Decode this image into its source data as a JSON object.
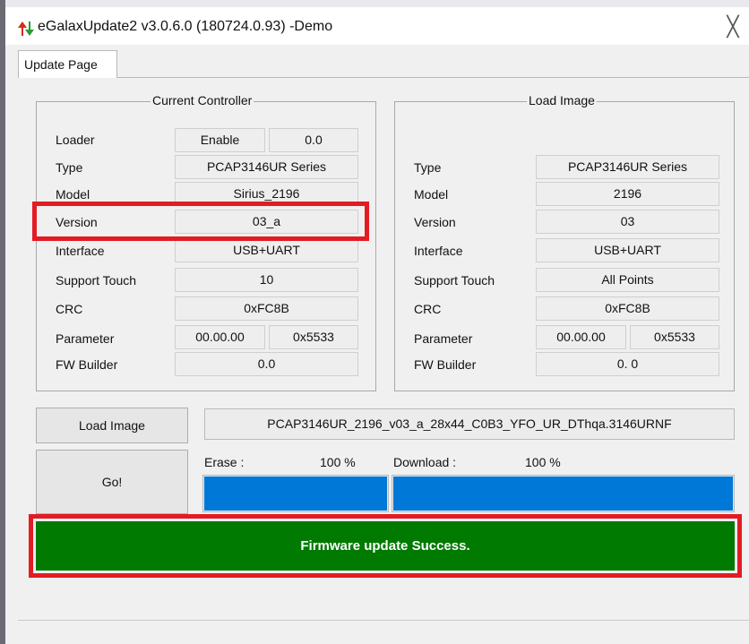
{
  "window": {
    "title": "eGalaxUpdate2 v3.0.6.0 (180724.0.93) -Demo",
    "close_glyph": "╳",
    "app_icon": "updown-arrows-icon"
  },
  "tabs": [
    {
      "label": "Update Page"
    }
  ],
  "current_controller": {
    "title": "Current Controller",
    "loader": {
      "label": "Loader",
      "value1": "Enable",
      "value2": "0.0"
    },
    "rows": [
      {
        "label": "Type",
        "value": "PCAP3146UR Series"
      },
      {
        "label": "Model",
        "value": "Sirius_2196"
      },
      {
        "label": "Version",
        "value": "03_a"
      },
      {
        "label": "Interface",
        "value": "USB+UART"
      },
      {
        "label": "Support Touch",
        "value": "10"
      },
      {
        "label": "CRC",
        "value": "0xFC8B"
      }
    ],
    "parameter": {
      "label": "Parameter",
      "value1": "00.00.00",
      "value2": "0x5533"
    },
    "fw_builder": {
      "label": "FW Builder",
      "value": "0.0"
    }
  },
  "load_image": {
    "title": "Load Image",
    "rows": [
      {
        "label": "Type",
        "value": "PCAP3146UR Series"
      },
      {
        "label": "Model",
        "value": "2196"
      },
      {
        "label": "Version",
        "value": "03"
      },
      {
        "label": "Interface",
        "value": "USB+UART"
      },
      {
        "label": "Support Touch",
        "value": "All Points"
      },
      {
        "label": "CRC",
        "value": "0xFC8B"
      }
    ],
    "parameter": {
      "label": "Parameter",
      "value1": "00.00.00",
      "value2": "0x5533"
    },
    "fw_builder": {
      "label": "FW Builder",
      "value": "0. 0"
    }
  },
  "actions": {
    "load_image_button": "Load Image",
    "image_file": "PCAP3146UR_2196_v03_a_28x44_C0B3_YFO_UR_DThqa.3146URNF",
    "go_button": "Go!"
  },
  "progress": {
    "erase_label": "Erase :",
    "erase_percent": "100 %",
    "erase_fraction": 1.0,
    "download_label": "Download :",
    "download_percent": "100 %",
    "download_fraction": 1.0,
    "bar_color": "#0078d7"
  },
  "status": {
    "message": "Firmware update Success.",
    "color": "#007a00"
  },
  "annotation_color": "#e31b23"
}
